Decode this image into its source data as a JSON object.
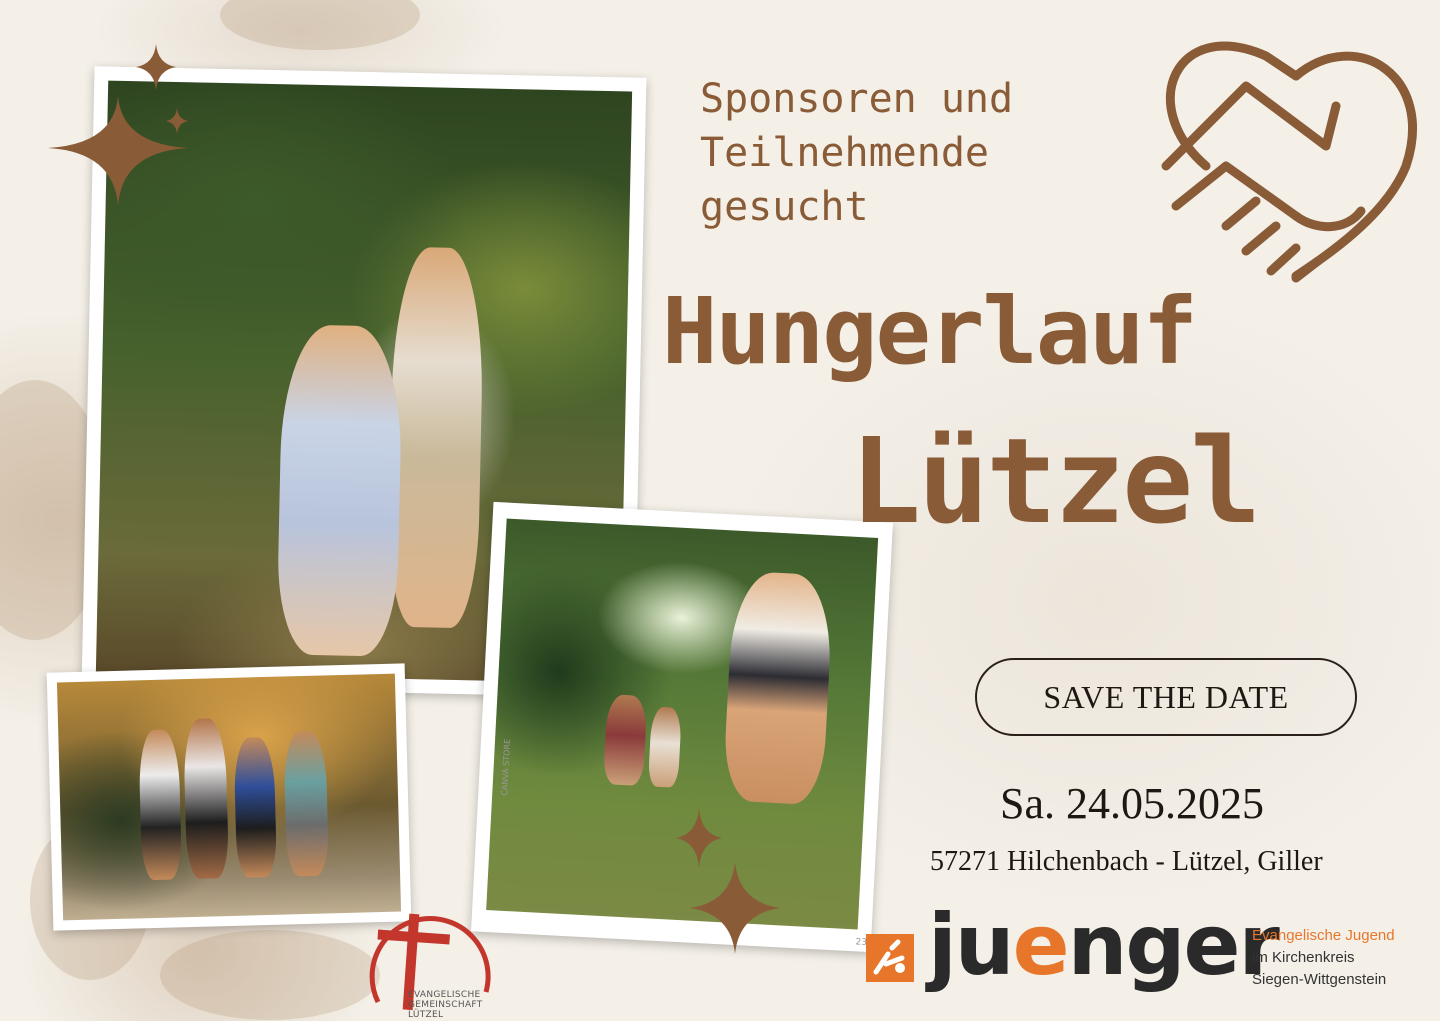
{
  "headline": {
    "subtitle_lines": [
      "Sponsoren und",
      "Teilnehmende",
      "gesucht"
    ],
    "title_line1": "Hungerlauf",
    "title_line2": "Lützel"
  },
  "event": {
    "save_label": "SAVE THE DATE",
    "date": "Sa. 24.05.2025",
    "location": "57271 Hilchenbach - Lützel, Giller"
  },
  "logos": {
    "church": {
      "lines": [
        "EVANGELISCHE",
        "GEMEINSCHAFT",
        "LÜTZEL"
      ]
    },
    "juenger": {
      "word_pre": "ju",
      "word_accent": "e",
      "word_post": "nger",
      "lines": [
        "Evangelische Jugend",
        "im Kirchenkreis",
        "Siegen-Wittgenstein"
      ]
    }
  },
  "photos": {
    "film_marks": [
      "CANVA STORE",
      "23"
    ]
  },
  "colors": {
    "accent_brown": "#8a5b37",
    "juenger_orange": "#e8762a",
    "cross_red": "#c2362b",
    "text_dark": "#1f1713"
  },
  "icons": [
    "handshake-heart-icon",
    "sparkle-icon",
    "cross-icon"
  ]
}
